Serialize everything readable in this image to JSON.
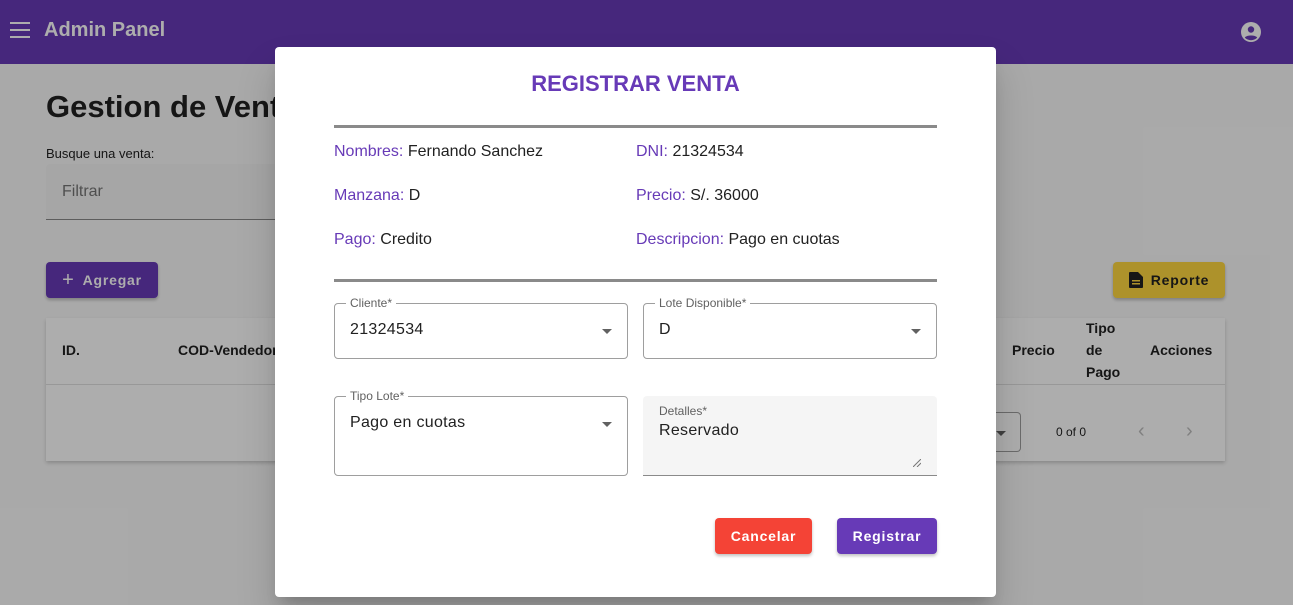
{
  "toolbar": {
    "title": "Admin Panel",
    "menu_icon": "menu-icon",
    "account_icon": "account-circle-icon",
    "color": "#673ab7"
  },
  "page": {
    "title": "Gestion de Ventas",
    "search_label": "Busque una venta:",
    "search_placeholder": "Filtrar",
    "add_button": "Agregar",
    "report_button": "Reporte"
  },
  "table": {
    "headers": [
      "ID.",
      "COD-Vendedor",
      "Precio",
      "Tipo de Pago",
      "Acciones"
    ],
    "range_label": "0 of 0"
  },
  "dialog": {
    "title": "REGISTRAR VENTA",
    "info": {
      "nombres_label": "Nombres:",
      "nombres_value": "Fernando Sanchez",
      "dni_label": "DNI:",
      "dni_value": "21324534",
      "manzana_label": "Manzana:",
      "manzana_value": "D",
      "precio_label": "Precio:",
      "precio_value": "S/. 36000",
      "pago_label": "Pago:",
      "pago_value": "Credito",
      "descripcion_label": "Descripcion:",
      "descripcion_value": "Pago en cuotas"
    },
    "fields": {
      "cliente_label": "Cliente*",
      "cliente_value": "21324534",
      "lote_label": "Lote Disponible*",
      "lote_value": "D",
      "tipo_lote_label": "Tipo Lote*",
      "tipo_lote_value": "Pago en cuotas",
      "detalles_label": "Detalles*",
      "detalles_value": "Reservado"
    },
    "cancel_button": "Cancelar",
    "register_button": "Registrar",
    "colors": {
      "accent": "#673ab7",
      "warn": "#f44336",
      "report": "#ffd740"
    }
  }
}
